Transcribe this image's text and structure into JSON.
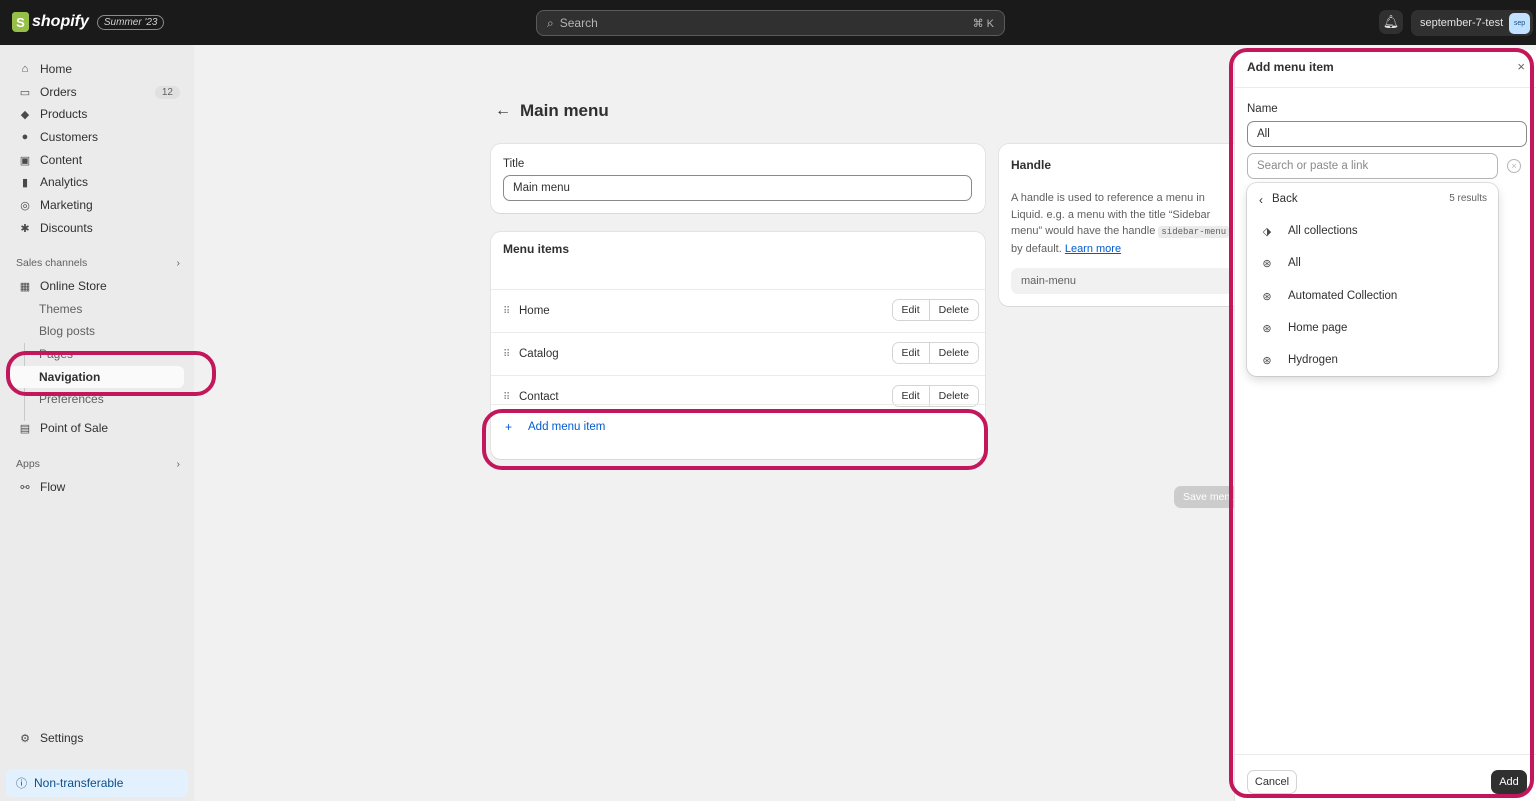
{
  "topbar": {
    "brand": "shopify",
    "brand_letter": "S",
    "edition": "Summer '23",
    "search_placeholder": "Search",
    "search_shortcut": "⌘ K",
    "store_name": "september-7-test",
    "avatar_initials": "sep"
  },
  "sidebar": {
    "items": [
      {
        "label": "Home",
        "icon": "home-icon"
      },
      {
        "label": "Orders",
        "icon": "inbox-icon",
        "badge": "12"
      },
      {
        "label": "Products",
        "icon": "tag-icon"
      },
      {
        "label": "Customers",
        "icon": "person-icon"
      },
      {
        "label": "Content",
        "icon": "image-icon"
      },
      {
        "label": "Analytics",
        "icon": "chart-icon"
      },
      {
        "label": "Marketing",
        "icon": "target-icon"
      },
      {
        "label": "Discounts",
        "icon": "discount-icon"
      }
    ],
    "sales_channels_label": "Sales channels",
    "online_store": "Online Store",
    "store_sub": [
      "Themes",
      "Blog posts",
      "Pages",
      "Navigation",
      "Preferences"
    ],
    "point_of_sale": "Point of Sale",
    "apps_label": "Apps",
    "flow": "Flow",
    "settings": "Settings",
    "banner": "Non-transferable"
  },
  "main": {
    "title": "Main menu",
    "title_field_label": "Title",
    "title_field_value": "Main menu",
    "menu_items_title": "Menu items",
    "menu_items": [
      {
        "name": "Home"
      },
      {
        "name": "Catalog"
      },
      {
        "name": "Contact"
      }
    ],
    "edit_label": "Edit",
    "delete_label": "Delete",
    "add_menu_item": "Add menu item",
    "handle": {
      "title": "Handle",
      "text_before": "A handle is used to reference a menu in Liquid. e.g. a menu with the title “Sidebar menu” would have the handle ",
      "code": "sidebar-menu",
      "text_after": " by default. ",
      "learn_more": "Learn more",
      "value": "main-menu"
    },
    "save_label": "Save menu"
  },
  "panel": {
    "title": "Add menu item",
    "name_label": "Name",
    "name_value": "All",
    "link_placeholder": "Search or paste a link",
    "back_label": "Back",
    "results_count": "5 results",
    "results": [
      {
        "label": "All collections",
        "icon": "collections-icon"
      },
      {
        "label": "All",
        "icon": "collection-icon"
      },
      {
        "label": "Automated Collection",
        "icon": "collection-icon"
      },
      {
        "label": "Home page",
        "icon": "collection-icon"
      },
      {
        "label": "Hydrogen",
        "icon": "collection-icon"
      }
    ],
    "cancel_label": "Cancel",
    "add_label": "Add"
  },
  "colors": {
    "topbar": "#1a1a1a",
    "highlight": "#c2185b",
    "link": "#005bd3",
    "primary_button": "#303030"
  }
}
